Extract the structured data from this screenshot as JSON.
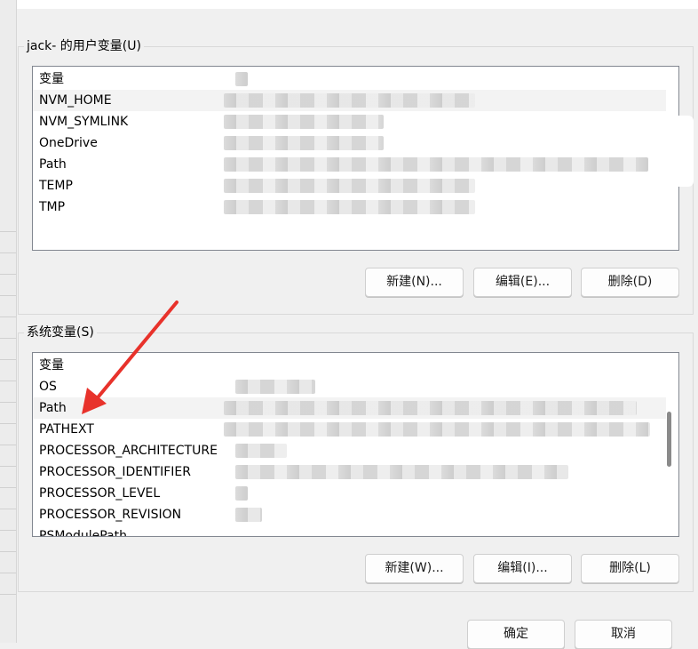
{
  "user_vars": {
    "legend": "jack- 的用户变量(U)",
    "header": "变量",
    "items": [
      "NVM_HOME",
      "NVM_SYMLINK",
      "OneDrive",
      "Path",
      "TEMP",
      "TMP"
    ],
    "buttons": {
      "new": "新建(N)...",
      "edit": "编辑(E)...",
      "delete": "删除(D)"
    }
  },
  "system_vars": {
    "legend": "系统变量(S)",
    "header": "变量",
    "items": [
      "OS",
      "Path",
      "PATHEXT",
      "PROCESSOR_ARCHITECTURE",
      "PROCESSOR_IDENTIFIER",
      "PROCESSOR_LEVEL",
      "PROCESSOR_REVISION",
      "PSModulePath"
    ],
    "buttons": {
      "new": "新建(W)...",
      "edit": "编辑(I)...",
      "delete": "删除(L)"
    }
  },
  "footer": {
    "ok": "确定",
    "cancel": "取消"
  },
  "annotation": {
    "arrow_color": "#e8322b",
    "points_to": "Path"
  }
}
